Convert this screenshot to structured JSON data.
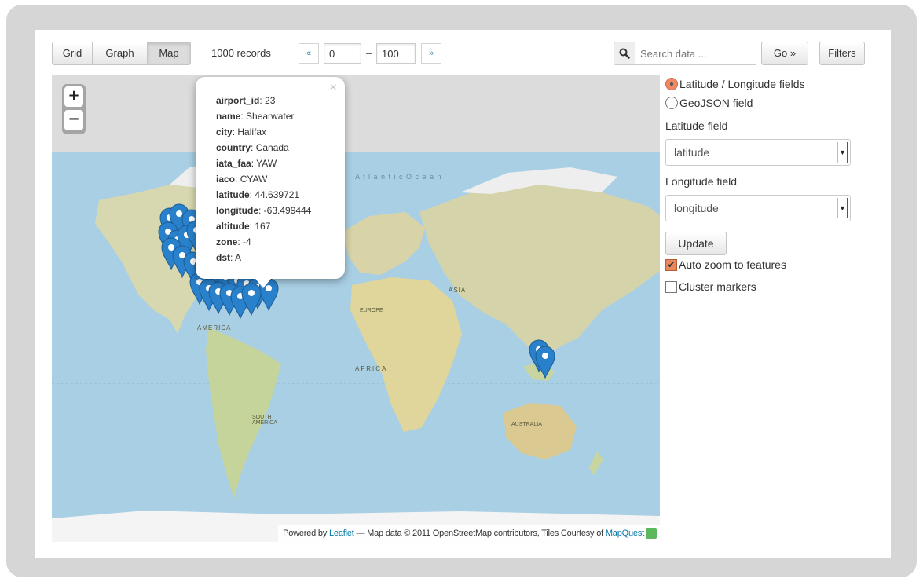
{
  "toolbar": {
    "view_tabs": [
      "Grid",
      "Graph",
      "Map"
    ],
    "active_tab": "Map",
    "records_count": "1000 records",
    "pager_prev": "«",
    "pager_next": "»",
    "pager_from": "0",
    "pager_dash": "–",
    "pager_to": "100",
    "search_placeholder": "Search data ...",
    "go_label": "Go »",
    "filters_label": "Filters"
  },
  "map": {
    "zoom_in": "+",
    "zoom_out": "−",
    "ocean_label": "A t l a n t i c   O c e a n",
    "region_labels": {
      "north_america": "AMERICA",
      "asia": "ASIA",
      "europe": "EUROPE",
      "africa": "AFRICA",
      "south_america": "SOUTH AMERICA",
      "australia": "AUSTRALIA"
    },
    "attribution": {
      "powered_by": "Powered by ",
      "leaflet": "Leaflet",
      "map_data": " — Map data © 2011 OpenStreetMap contributors, Tiles Courtesy of ",
      "mapquest": "MapQuest"
    },
    "popup": {
      "close": "×",
      "fields": [
        {
          "key": "airport_id",
          "value": "23"
        },
        {
          "key": "name",
          "value": "Shearwater"
        },
        {
          "key": "city",
          "value": "Halifax"
        },
        {
          "key": "country",
          "value": "Canada"
        },
        {
          "key": "iata_faa",
          "value": "YAW"
        },
        {
          "key": "iaco",
          "value": "CYAW"
        },
        {
          "key": "latitude",
          "value": "44.639721"
        },
        {
          "key": "longitude",
          "value": "-63.499444"
        },
        {
          "key": "altitude",
          "value": "167"
        },
        {
          "key": "zone",
          "value": "-4"
        },
        {
          "key": "dst",
          "value": "A"
        }
      ]
    },
    "marker_color": "#2a81cb"
  },
  "side": {
    "radio_latlon": "Latitude / Longitude fields",
    "radio_geojson": "GeoJSON field",
    "latitude_field_label": "Latitude field",
    "latitude_field_value": "latitude",
    "longitude_field_label": "Longitude field",
    "longitude_field_value": "longitude",
    "update_label": "Update",
    "auto_zoom_label": "Auto zoom to features",
    "cluster_label": "Cluster markers",
    "accent_color": "#e8875e"
  }
}
